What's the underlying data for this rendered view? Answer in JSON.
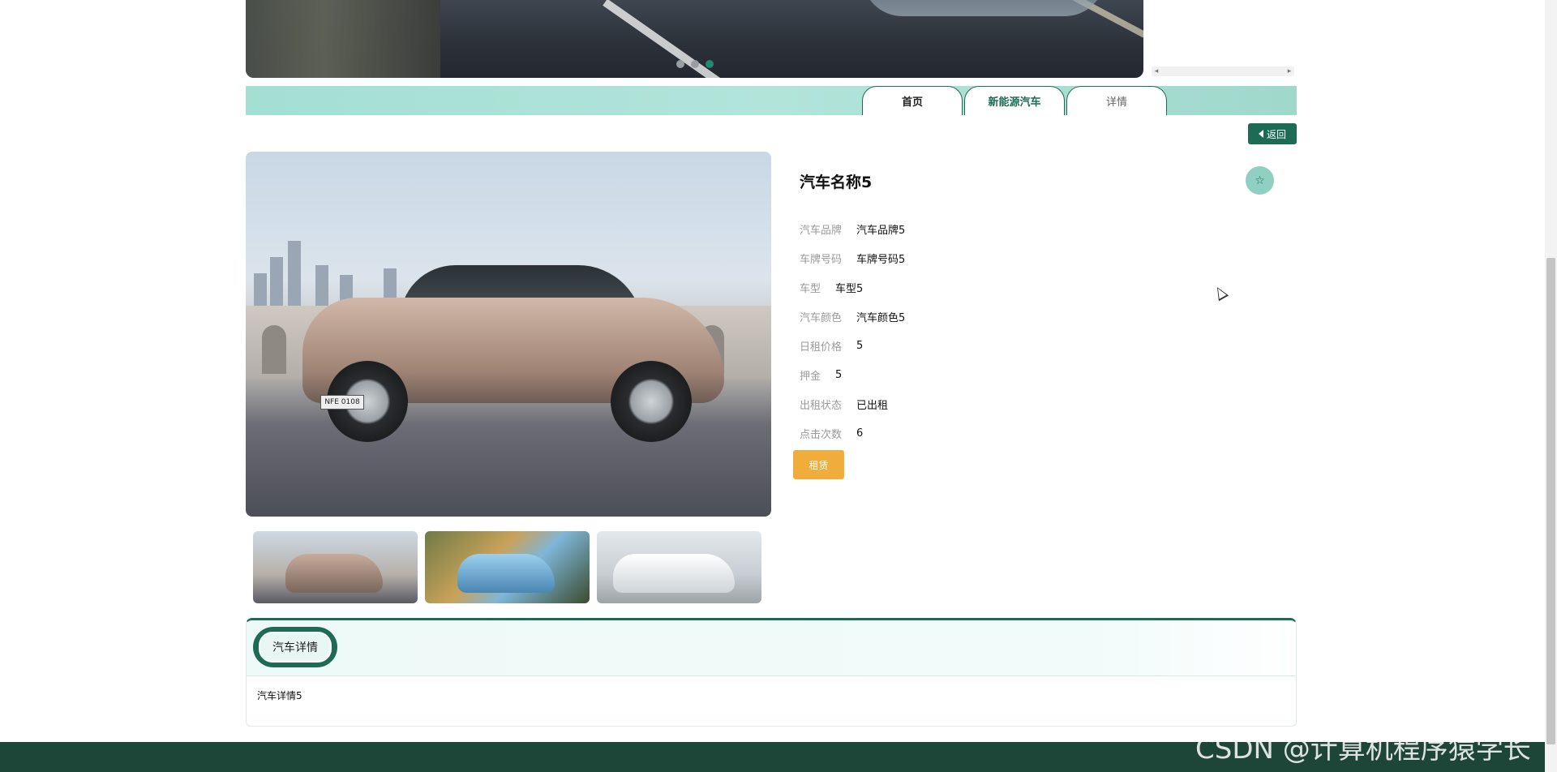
{
  "banner": {
    "dots": 3,
    "active_dot": 3
  },
  "nav": {
    "tabs": [
      {
        "label": "首页"
      },
      {
        "label": "新能源汽车"
      },
      {
        "label": "详情"
      }
    ],
    "back_label": "返回"
  },
  "car": {
    "name": "汽车名称5",
    "plate_text": "NFE 0108",
    "favorite_icon": "star-outline-icon",
    "fields": [
      {
        "label": "汽车品牌",
        "value": "汽车品牌5"
      },
      {
        "label": "车牌号码",
        "value": "车牌号码5"
      },
      {
        "label": "车型",
        "value": "车型5"
      },
      {
        "label": "汽车颜色",
        "value": "汽车颜色5"
      },
      {
        "label": "日租价格",
        "value": "5"
      },
      {
        "label": "押金",
        "value": "5"
      },
      {
        "label": "出租状态",
        "value": "已出租"
      },
      {
        "label": "点击次数",
        "value": "6"
      }
    ],
    "rent_label": "租赁"
  },
  "detail": {
    "tab_label": "汽车详情",
    "content": "汽车详情5"
  },
  "watermark": "CSDN @计算机程序猿学长",
  "colors": {
    "primary": "#1d6b55",
    "accent": "#f0ad3c",
    "navbar": "#a4dfd3",
    "footer": "#1e4638"
  }
}
